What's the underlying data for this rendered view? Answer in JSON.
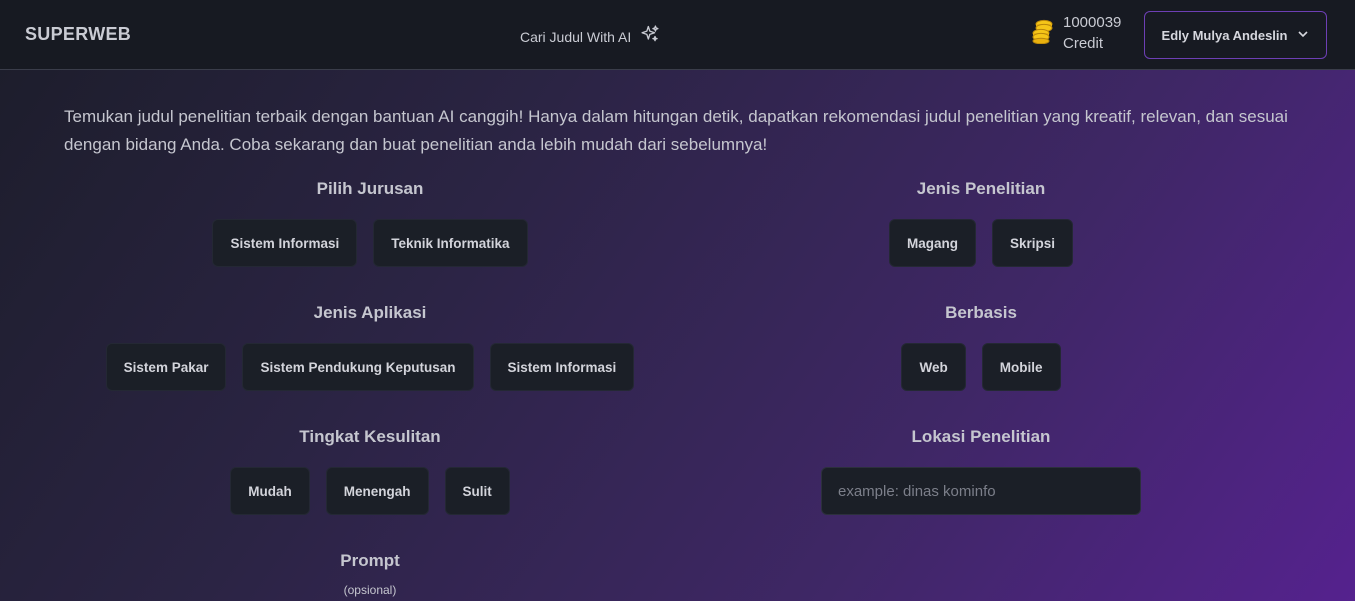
{
  "navbar": {
    "brand": "SUPERWEB",
    "ai_link": "Cari Judul With AI",
    "ai_icon": "sparkles-icon",
    "credit_amount": "1000039",
    "credit_label": "Credit",
    "credit_icon": "coins-icon",
    "user_name": "Edly Mulya Andeslin",
    "accent_color": "#6d3fb5"
  },
  "intro": "Temukan judul penelitian terbaik dengan bantuan AI canggih! Hanya dalam hitungan detik, dapatkan rekomendasi judul penelitian yang kreatif, relevan, dan sesuai dengan bidang Anda. Coba sekarang dan buat penelitian anda lebih mudah dari sebelumnya!",
  "jurusan": {
    "title": "Pilih Jurusan",
    "options": [
      "Sistem Informasi",
      "Teknik Informatika"
    ]
  },
  "jenis_penelitian": {
    "title": "Jenis Penelitian",
    "options": [
      "Magang",
      "Skripsi"
    ]
  },
  "jenis_aplikasi": {
    "title": "Jenis Aplikasi",
    "options": [
      "Sistem Pakar",
      "Sistem Pendukung Keputusan",
      "Sistem Informasi"
    ]
  },
  "berbasis": {
    "title": "Berbasis",
    "options": [
      "Web",
      "Mobile"
    ]
  },
  "tingkat": {
    "title": "Tingkat Kesulitan",
    "options": [
      "Mudah",
      "Menengah",
      "Sulit"
    ]
  },
  "lokasi": {
    "title": "Lokasi Penelitian",
    "placeholder": "example: dinas kominfo"
  },
  "prompt": {
    "title": "Prompt",
    "note": "(opsional)"
  }
}
